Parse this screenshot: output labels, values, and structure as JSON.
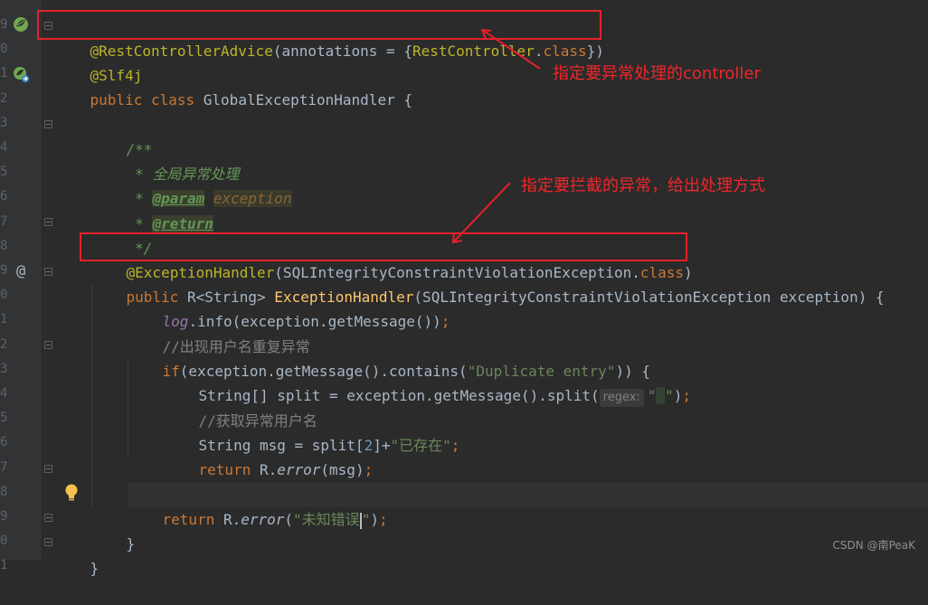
{
  "gutter": {
    "line_numbers": [
      "9",
      "0",
      "1",
      "2",
      "3",
      "4",
      "5",
      "6",
      "7",
      "8",
      "9",
      "0",
      "1",
      "2",
      "3",
      "4",
      "5",
      "6",
      "7",
      "8",
      "9",
      "0",
      "1"
    ]
  },
  "code": {
    "l1": {
      "ann": "@RestControllerAdvice",
      "p1": "(annotations = {",
      "cls": "RestController",
      "p2": ".",
      "kw": "class",
      "p3": "})"
    },
    "l2": {
      "ann": "@Slf4j"
    },
    "l3": {
      "kw1": "public",
      "kw2": "class",
      "name": "GlobalExceptionHandler",
      "rest": " {"
    },
    "l5": {
      "doc": "/**"
    },
    "l6": {
      "doc": " * 全局异常处理"
    },
    "l7": {
      "star": " * ",
      "tag": "@param",
      "sp": " ",
      "param": "exception"
    },
    "l8": {
      "star": " * ",
      "tag": "@return"
    },
    "l9": {
      "doc": " */"
    },
    "l10": {
      "ann": "@ExceptionHandler",
      "p1": "(SQLIntegrityConstraintViolationException.",
      "kw": "class",
      "p2": ")"
    },
    "l11": {
      "kw": "public",
      "p1": " R<String> ",
      "fn": "ExceptionHandler",
      "p2": "(SQLIntegrityConstraintViolationException exception) {"
    },
    "l12": {
      "field": "log",
      "p1": ".info(exception.getMessage())",
      "semi": ";"
    },
    "l13": {
      "cmt": "//出现用户名重复异常"
    },
    "l14": {
      "kw": "if",
      "p1": "(exception.getMessage().contains(",
      "str": "\"Duplicate entry\"",
      "p2": ")) {"
    },
    "l15": {
      "p1": "String[] split = exception.getMessage().split(",
      "hint": "regex:",
      "q1": "\"",
      "sp": " ",
      "q2": "\"",
      "p2": ")",
      "semi": ";"
    },
    "l16": {
      "cmt": "//获取异常用户名"
    },
    "l17": {
      "p1": "String msg = split[",
      "num": "2",
      "p2": "]+",
      "str": "\"已存在\"",
      "semi": ";"
    },
    "l18": {
      "kw": "return",
      "p1": " R.",
      "it": "error",
      "p2": "(msg)",
      "semi": ";"
    },
    "l19": {
      "p1": "}"
    },
    "l20": {
      "kw": "return",
      "p1": " R.",
      "it": "error",
      "p2": "(",
      "str1": "\"未知错误",
      "str2": "\"",
      "p3": ")",
      "semi": ";"
    },
    "l21": {
      "p1": "}"
    },
    "l22": {
      "p1": "}"
    }
  },
  "annotations": {
    "note1": "指定要异常处理的controller",
    "note2": "指定要拦截的异常，给出处理方式",
    "color": "#e4212a"
  },
  "gutter_icons": {
    "l1": "spring-bean-icon",
    "l3": "spring-bean-navigate-icon",
    "l11": "implements-at-icon",
    "l11_symbol": "@",
    "l20": "lightbulb-icon"
  },
  "watermark": "CSDN @南PeaK"
}
